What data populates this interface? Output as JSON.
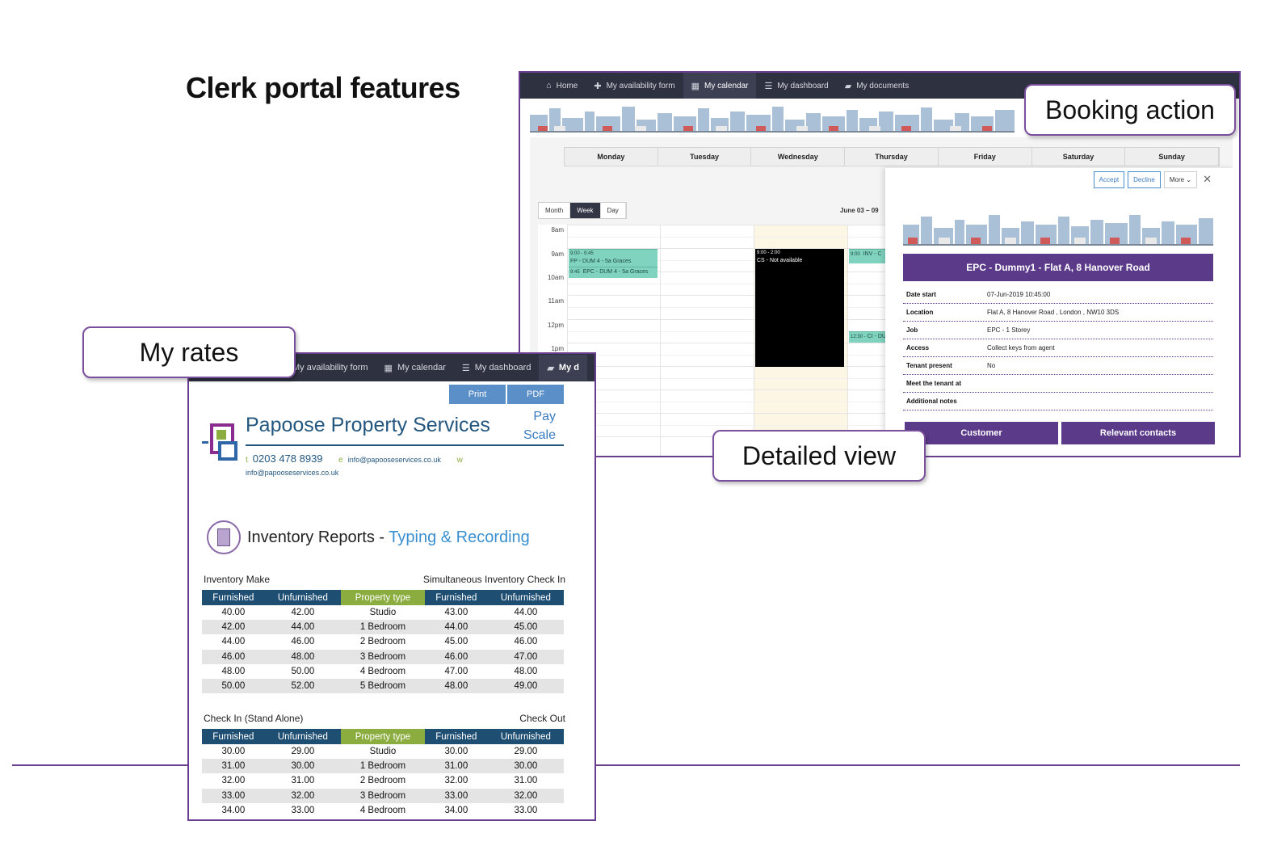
{
  "slide": {
    "title": "Clerk portal features"
  },
  "callouts": {
    "booking_action": "Booking action",
    "my_rates": "My rates",
    "detailed_view": "Detailed view"
  },
  "calendar_nav": [
    {
      "label": "Home",
      "icon": "home-icon"
    },
    {
      "label": "My availability form",
      "icon": "plus-icon"
    },
    {
      "label": "My calendar",
      "icon": "calendar-icon"
    },
    {
      "label": "My dashboard",
      "icon": "list-icon"
    },
    {
      "label": "My documents",
      "icon": "folder-icon"
    }
  ],
  "calendar": {
    "days": [
      "Monday",
      "Tuesday",
      "Wednesday",
      "Thursday",
      "Friday",
      "Saturday",
      "Sunday"
    ],
    "view_tabs": [
      "Month",
      "Week",
      "Day"
    ],
    "active_view": "Week",
    "range": "June 03 – 09",
    "times": [
      "8am",
      "9am",
      "10am",
      "11am",
      "12pm",
      "1pm"
    ],
    "events": {
      "e1_time": "9:00 - 9:45",
      "e1_title": "FP - DUM 4 - 5a Graces",
      "e2_time": "9:45",
      "e2_title": "EPC - DUM 4 - 5a Graces",
      "e3_time": "9:00 - 2:00",
      "e3_title": "CS - Not available",
      "e4_time": "9:00",
      "e4_title": "INV - C",
      "e5_time": "12:30 -",
      "e5_title": "CI - DU"
    }
  },
  "detail": {
    "accept": "Accept",
    "decline": "Decline",
    "more": "More",
    "title": "EPC - Dummy1 - Flat A, 8 Hanover Road",
    "rows": [
      {
        "k": "Date start",
        "v": "07-Jun-2019 10:45:00"
      },
      {
        "k": "Location",
        "v": "Flat A, 8 Hanover Road , London , NW10 3DS"
      },
      {
        "k": "Job",
        "v": "EPC - 1 Storey"
      },
      {
        "k": "Access",
        "v": "Collect keys from agent"
      },
      {
        "k": "Tenant present",
        "v": "No"
      },
      {
        "k": "Meet the tenant at",
        "v": ""
      },
      {
        "k": "Additional notes",
        "v": ""
      }
    ],
    "customer_btn": "Customer",
    "contacts_btn": "Relevant contacts"
  },
  "rates_nav": [
    {
      "label": "My availability form",
      "icon": "plus-icon"
    },
    {
      "label": "My calendar",
      "icon": "calendar-icon"
    },
    {
      "label": "My dashboard",
      "icon": "list-icon"
    },
    {
      "label": "My d",
      "icon": "folder-icon"
    }
  ],
  "rates": {
    "print": "Print",
    "pdf": "PDF",
    "company": "Papoose Property Services",
    "pay": "Pay",
    "scale": "Scale",
    "t_label": "t",
    "phone": "0203 478 8939",
    "e_label": "e",
    "email": "info@papooseservices.co.uk",
    "w_label": "w",
    "email2": "info@papooseservices.co.uk",
    "section_a": "Inventory Reports - ",
    "section_b": "Typing & Recording",
    "headers": [
      "Furnished",
      "Unfurnished",
      "Property type",
      "Furnished",
      "Unfurnished"
    ],
    "table1_left": "Inventory Make",
    "table1_right": "Simultaneous Inventory Check In",
    "table1": [
      [
        "40.00",
        "42.00",
        "Studio",
        "43.00",
        "44.00"
      ],
      [
        "42.00",
        "44.00",
        "1 Bedroom",
        "44.00",
        "45.00"
      ],
      [
        "44.00",
        "46.00",
        "2 Bedroom",
        "45.00",
        "46.00"
      ],
      [
        "46.00",
        "48.00",
        "3 Bedroom",
        "46.00",
        "47.00"
      ],
      [
        "48.00",
        "50.00",
        "4 Bedroom",
        "47.00",
        "48.00"
      ],
      [
        "50.00",
        "52.00",
        "5 Bedroom",
        "48.00",
        "49.00"
      ]
    ],
    "table2_left": "Check In (Stand Alone)",
    "table2_right": "Check Out",
    "table2": [
      [
        "30.00",
        "29.00",
        "Studio",
        "30.00",
        "29.00"
      ],
      [
        "31.00",
        "30.00",
        "1 Bedroom",
        "31.00",
        "30.00"
      ],
      [
        "32.00",
        "31.00",
        "2 Bedroom",
        "32.00",
        "31.00"
      ],
      [
        "33.00",
        "32.00",
        "3 Bedroom",
        "33.00",
        "32.00"
      ],
      [
        "34.00",
        "33.00",
        "4 Bedroom",
        "34.00",
        "33.00"
      ]
    ]
  },
  "colors": {
    "purple": "#5b3a8a",
    "navy": "#1f4e73",
    "green": "#8bac3f",
    "teal_event": "#7fd3bf",
    "nav_bg": "#2e3140"
  }
}
